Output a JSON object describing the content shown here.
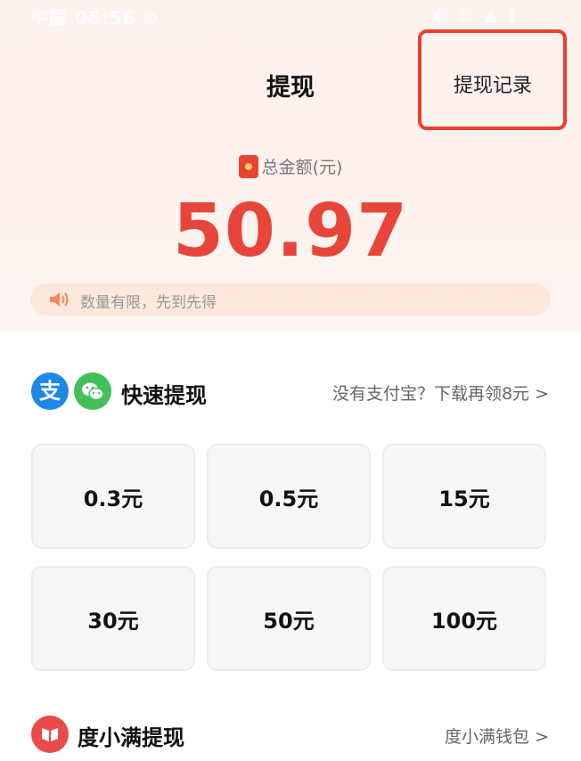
{
  "status_bar": {
    "left_text": "中国 05:56 ⊙",
    "right_text": "◐ ◎ ▲ ▮"
  },
  "header": {
    "title": "提现",
    "record_link": "提现记录"
  },
  "balance": {
    "label": "总金额(元)",
    "amount": "50.97",
    "icon": "red-packet-icon"
  },
  "notice": {
    "text": "数量有限，先到先得",
    "icon": "speaker-icon"
  },
  "quick_withdraw": {
    "title": "快速提现",
    "alipay_glyph": "支",
    "link": "没有支付宝？下载再领8元 >",
    "options": [
      "0.3元",
      "0.5元",
      "15元",
      "30元",
      "50元",
      "100元"
    ]
  },
  "duxiaoman": {
    "title": "度小满提现",
    "link": "度小满钱包 >"
  },
  "colors": {
    "accent_red": "#e8453a",
    "highlight_border": "#e8402f",
    "alipay_blue": "#1e88e5",
    "wechat_green": "#43c05a"
  }
}
